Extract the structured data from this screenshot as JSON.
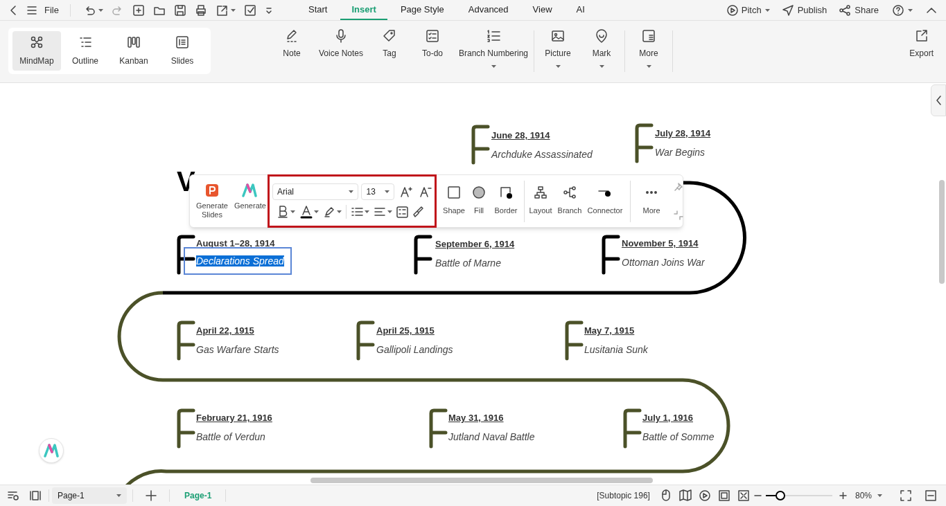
{
  "top_bar": {
    "file": "File",
    "tabs": [
      {
        "label": "Start",
        "selected": false
      },
      {
        "label": "Insert",
        "selected": true
      },
      {
        "label": "Page Style",
        "selected": false
      },
      {
        "label": "Advanced",
        "selected": false
      },
      {
        "label": "View",
        "selected": false
      },
      {
        "label": "AI",
        "selected": false
      }
    ],
    "pitch": "Pitch",
    "publish": "Publish",
    "share": "Share"
  },
  "ribbon": {
    "views": [
      {
        "label": "MindMap",
        "selected": true
      },
      {
        "label": "Outline",
        "selected": false
      },
      {
        "label": "Kanban",
        "selected": false
      },
      {
        "label": "Slides",
        "selected": false
      }
    ],
    "tools": [
      {
        "label": "Note",
        "dropdown": false
      },
      {
        "label": "Voice Notes",
        "dropdown": false
      },
      {
        "label": "Tag",
        "dropdown": false
      },
      {
        "label": "To-do",
        "dropdown": false
      },
      {
        "label": "Branch Numbering",
        "dropdown": true
      },
      {
        "label": "Picture",
        "dropdown": true
      },
      {
        "label": "Mark",
        "dropdown": true
      },
      {
        "label": "More",
        "dropdown": true
      }
    ],
    "export": "Export"
  },
  "canvas": {
    "title": "V",
    "events": [
      {
        "date": "June 28, 1914",
        "description": "Archduke Assassinated",
        "color": "#4b5128",
        "selected": false
      },
      {
        "date": "July 28, 1914",
        "description": "War Begins",
        "color": "#4b5128",
        "selected": false
      },
      {
        "date": "August 1–28, 1914",
        "description": "Declarations Spread",
        "color": "#000000",
        "selected": true
      },
      {
        "date": "September 6, 1914",
        "description": "Battle of Marne",
        "color": "#000000",
        "selected": false
      },
      {
        "date": "November 5, 1914",
        "description": "Ottoman Joins War",
        "color": "#000000",
        "selected": false
      },
      {
        "date": "April 22, 1915",
        "description": "Gas Warfare Starts",
        "color": "#4b5128",
        "selected": false
      },
      {
        "date": "April 25, 1915",
        "description": "Gallipoli Landings",
        "color": "#4b5128",
        "selected": false
      },
      {
        "date": "May 7, 1915",
        "description": "Lusitania Sunk",
        "color": "#4b5128",
        "selected": false
      },
      {
        "date": "February 21, 1916",
        "description": "Battle of Verdun",
        "color": "#4b5128",
        "selected": false
      },
      {
        "date": "May 31, 1916",
        "description": "Jutland Naval Battle",
        "color": "#4b5128",
        "selected": false
      },
      {
        "date": "July 1, 1916",
        "description": "Battle of Somme",
        "color": "#4b5128",
        "selected": false
      }
    ],
    "floating_toolbar": {
      "generate": [
        "Generate Slides",
        "Generate"
      ],
      "font": "Arial",
      "size": "13",
      "shape_tools": [
        "Shape",
        "Fill",
        "Border"
      ],
      "layout_tools": [
        "Layout",
        "Branch",
        "Connector"
      ],
      "more": "More"
    }
  },
  "status_bar": {
    "page_select": "Page-1",
    "page_tab": "Page-1",
    "subtopic": "[Subtopic 196]",
    "zoom": {
      "level": 0.22,
      "reading": "80%"
    }
  }
}
